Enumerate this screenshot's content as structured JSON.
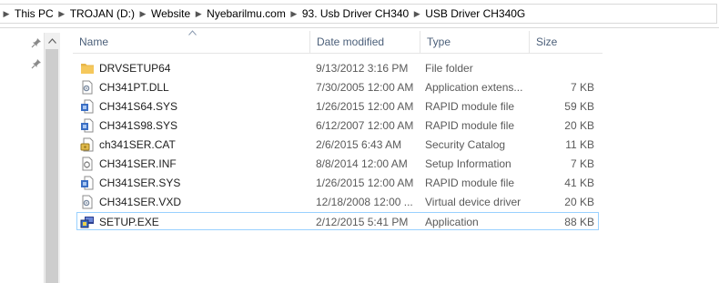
{
  "breadcrumb": [
    {
      "label": "This PC"
    },
    {
      "label": "TROJAN (D:)"
    },
    {
      "label": "Website"
    },
    {
      "label": "Nyebarilmu.com"
    },
    {
      "label": "93. Usb Driver CH340"
    },
    {
      "label": "USB Driver CH340G"
    }
  ],
  "columns": {
    "name": "Name",
    "date": "Date modified",
    "type": "Type",
    "size": "Size"
  },
  "files": [
    {
      "name": "DRVSETUP64",
      "date": "9/13/2012 3:16 PM",
      "type": "File folder",
      "size": "",
      "icon": "folder-icon"
    },
    {
      "name": "CH341PT.DLL",
      "date": "7/30/2005 12:00 AM",
      "type": "Application extens...",
      "size": "7 KB",
      "icon": "dll-file-icon"
    },
    {
      "name": "CH341S64.SYS",
      "date": "1/26/2015 12:00 AM",
      "type": "RAPID module file",
      "size": "59 KB",
      "icon": "sys-file-icon"
    },
    {
      "name": "CH341S98.SYS",
      "date": "6/12/2007 12:00 AM",
      "type": "RAPID module file",
      "size": "20 KB",
      "icon": "sys-file-icon"
    },
    {
      "name": "ch341SER.CAT",
      "date": "2/6/2015 6:43 AM",
      "type": "Security Catalog",
      "size": "11 KB",
      "icon": "security-catalog-icon"
    },
    {
      "name": "CH341SER.INF",
      "date": "8/8/2014 12:00 AM",
      "type": "Setup Information",
      "size": "7 KB",
      "icon": "inf-file-icon"
    },
    {
      "name": "CH341SER.SYS",
      "date": "1/26/2015 12:00 AM",
      "type": "RAPID module file",
      "size": "41 KB",
      "icon": "sys-file-icon"
    },
    {
      "name": "CH341SER.VXD",
      "date": "12/18/2008 12:00 ...",
      "type": "Virtual device driver",
      "size": "20 KB",
      "icon": "vxd-file-icon"
    },
    {
      "name": "SETUP.EXE",
      "date": "2/12/2015 5:41 PM",
      "type": "Application",
      "size": "88 KB",
      "icon": "setup-exe-icon",
      "selected": true
    }
  ],
  "colors": {
    "header_text": "#4c607a",
    "selection_border": "#99d1ff",
    "folder": "#f5c85c"
  }
}
